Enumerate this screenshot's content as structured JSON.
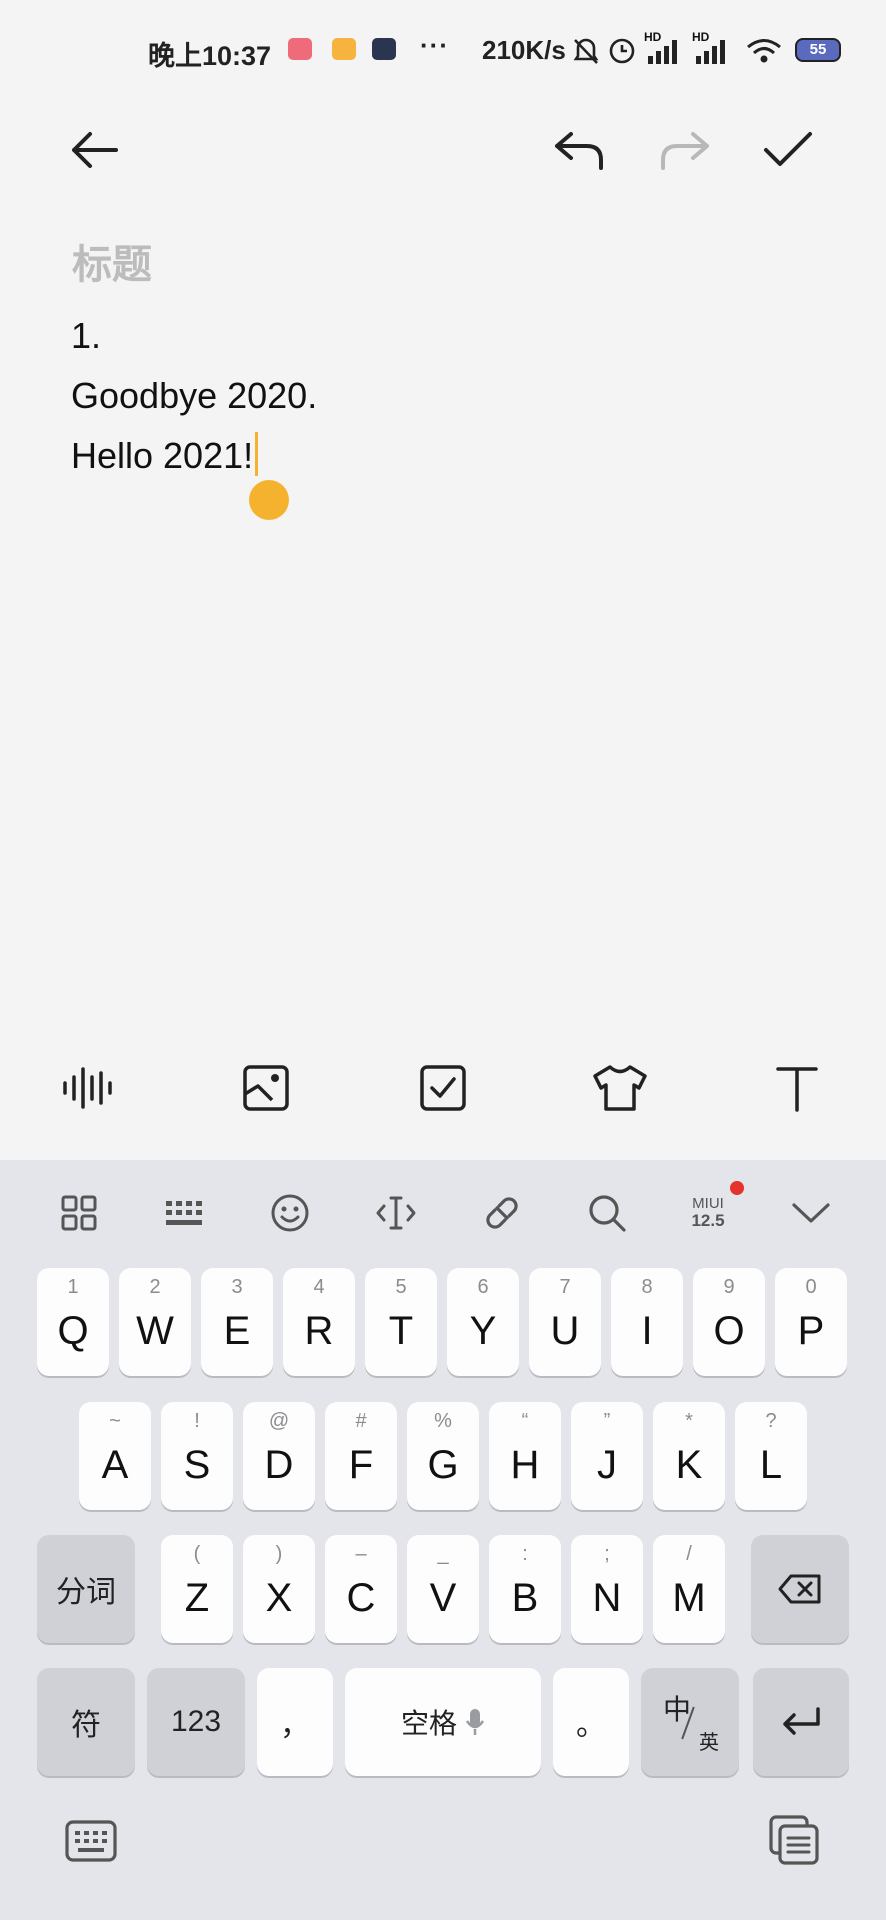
{
  "status_bar": {
    "time": "晚上10:37",
    "more": "···",
    "net_speed": "210K/s",
    "signal1": "HD",
    "signal2": "HD",
    "battery": "55"
  },
  "toolbar": {
    "back_icon": "arrow-left-icon",
    "undo_icon": "undo-icon",
    "redo_icon": "redo-icon",
    "done_icon": "check-icon"
  },
  "editor": {
    "title_placeholder": "标题",
    "lines": [
      "1.",
      "Goodbye 2020.",
      "Hello 2021!"
    ],
    "accent_color": "#f5b22e"
  },
  "format_toolbar": {
    "items": [
      "audio-icon",
      "image-icon",
      "checklist-icon",
      "theme-shirt-icon",
      "text-format-icon"
    ]
  },
  "keyboard_toolbar": {
    "items": [
      "grid-icon",
      "keyboard-layout-icon",
      "emoji-icon",
      "cursor-icon",
      "link-icon",
      "search-icon",
      "miui-logo",
      "collapse-chevron-icon"
    ],
    "miui_line1": "MIUI",
    "miui_line2": "12.5"
  },
  "keys": {
    "row1": [
      {
        "main": "Q",
        "sub": "1"
      },
      {
        "main": "W",
        "sub": "2"
      },
      {
        "main": "E",
        "sub": "3"
      },
      {
        "main": "R",
        "sub": "4"
      },
      {
        "main": "T",
        "sub": "5"
      },
      {
        "main": "Y",
        "sub": "6"
      },
      {
        "main": "U",
        "sub": "7"
      },
      {
        "main": "I",
        "sub": "8"
      },
      {
        "main": "O",
        "sub": "9"
      },
      {
        "main": "P",
        "sub": "0"
      }
    ],
    "row2": [
      {
        "main": "A",
        "sub": "~"
      },
      {
        "main": "S",
        "sub": "!"
      },
      {
        "main": "D",
        "sub": "@"
      },
      {
        "main": "F",
        "sub": "#"
      },
      {
        "main": "G",
        "sub": "%"
      },
      {
        "main": "H",
        "sub": "“"
      },
      {
        "main": "J",
        "sub": "”"
      },
      {
        "main": "K",
        "sub": "*"
      },
      {
        "main": "L",
        "sub": "?"
      }
    ],
    "row3": [
      {
        "main": "Z",
        "sub": "("
      },
      {
        "main": "X",
        "sub": ")"
      },
      {
        "main": "C",
        "sub": "–"
      },
      {
        "main": "V",
        "sub": "_"
      },
      {
        "main": "B",
        "sub": ":"
      },
      {
        "main": "N",
        "sub": ";"
      },
      {
        "main": "M",
        "sub": "/"
      }
    ],
    "segment": "分词",
    "symbols": "符",
    "numbers": "123",
    "comma": "，",
    "space": "空格",
    "period": "。",
    "lang_top": "中",
    "lang_bottom": "英",
    "backspace_icon": "backspace-icon",
    "enter_icon": "enter-icon"
  },
  "bottom_bar": {
    "left_icon": "keyboard-hide-icon",
    "right_icon": "clipboard-icon"
  }
}
